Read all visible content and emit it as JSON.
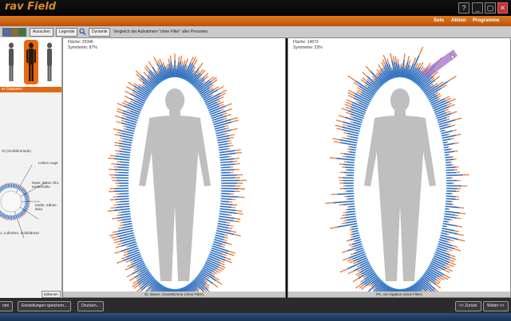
{
  "app": {
    "title": "rav Field"
  },
  "window_controls": {
    "help": "?",
    "minimize": "_",
    "restore": "▢",
    "close": "✕"
  },
  "menu": {
    "items": [
      "Solo",
      "Aktion",
      "Programme"
    ]
  },
  "toolbar": {
    "hide_label": "Ausschen",
    "legend_label": "Legende",
    "dynamic_label": "Dynamik",
    "hint": "Vergleich der Aufnahmen \"ohne Filter\" aller Personen"
  },
  "left_panel": {
    "strip_label": "er Gaussen",
    "labels": [
      "ch (Großhirnrinde)",
      "Linkes Auge",
      "Nase, linkes Ohr, Kieferhöhle",
      "Kiefer, Zähne links",
      "1, Luftröhre, Schilddrüse"
    ],
    "detail_button": "Edkenen"
  },
  "panel1": {
    "line1": "Fläche: 25346",
    "line2": "Symmetrie: 87%",
    "caption": "Dr. Bauer, Grundstimme (ohne Filter)"
  },
  "panel2": {
    "line1": "Fläche: 14673",
    "line2": "Symmetrie: 23%",
    "caption": "PK, vor Irigation (ohne Filter)"
  },
  "bottom": {
    "left_label": "rien",
    "settings_label": "Einstellungen speichern...",
    "print_label": "Drucken...",
    "back_label": "<< Zurück",
    "next_label": "Weiter >>"
  },
  "colors": {
    "accent": "#e07a1c",
    "aura_inner": "#1a6fd0",
    "aura_outer": "#e06a2a",
    "body": "#bfbfbf"
  },
  "icons": [
    "help-icon",
    "minimize-icon",
    "restore-icon",
    "close-icon",
    "search-icon"
  ]
}
